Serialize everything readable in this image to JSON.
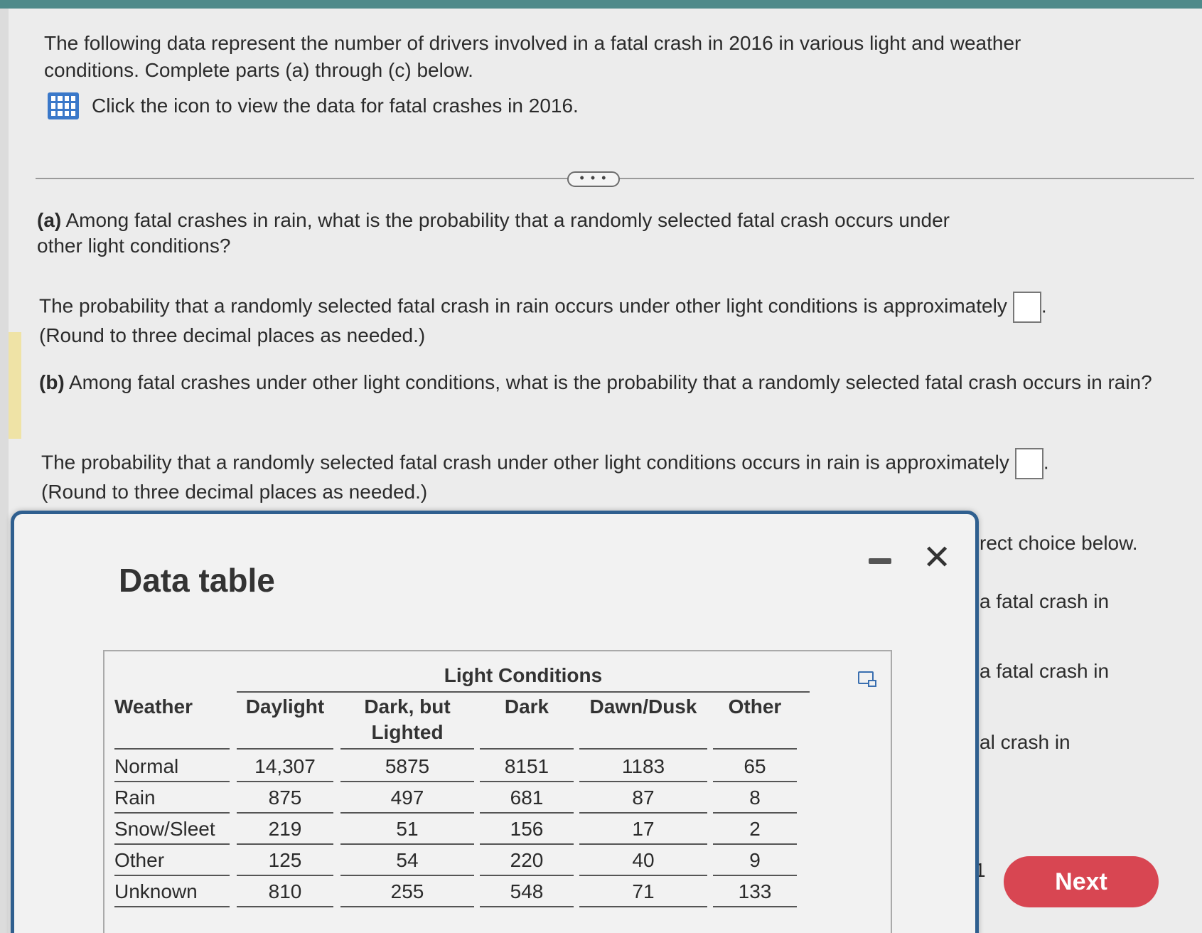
{
  "intro": {
    "text": "The following data represent the number of drivers involved in a fatal crash in 2016 in various light and weather conditions. Complete parts (a) through (c) below.",
    "data_link": "Click the icon to view the data for fatal crashes in 2016."
  },
  "more_label": "• • •",
  "part_a": {
    "label": "(a)",
    "question": "Among fatal crashes in rain, what is the probability that a randomly selected fatal crash occurs under other light conditions?",
    "answer_prefix": "The probability that a randomly selected fatal crash in rain occurs under other light conditions is approximately",
    "round_note": "(Round to three decimal places as needed.)"
  },
  "part_b": {
    "label": "(b)",
    "question": "Among fatal crashes under other light conditions, what is the probability that a randomly selected fatal crash occurs in rain?",
    "answer_prefix": "The probability that a randomly selected fatal crash under other light conditions occurs in rain is approximately",
    "round_note": "(Round to three decimal places as needed.)"
  },
  "behind_modal": {
    "line1": "rect choice below.",
    "line2": "a fatal crash in",
    "line3": "a fatal crash in",
    "line4": "al crash in",
    "one": "1"
  },
  "next_button": "Next",
  "modal": {
    "title": "Data table",
    "close_glyph": "✕",
    "table": {
      "group_header": "Light Conditions",
      "headers": [
        "Weather",
        "Daylight",
        "Dark, but\nLighted",
        "Dark",
        "Dawn/Dusk",
        "Other"
      ],
      "rows": [
        [
          "Normal",
          "14,307",
          "5875",
          "8151",
          "1183",
          "65"
        ],
        [
          "Rain",
          "875",
          "497",
          "681",
          "87",
          "8"
        ],
        [
          "Snow/Sleet",
          "219",
          "51",
          "156",
          "17",
          "2"
        ],
        [
          "Other",
          "125",
          "54",
          "220",
          "40",
          "9"
        ],
        [
          "Unknown",
          "810",
          "255",
          "548",
          "71",
          "133"
        ]
      ]
    }
  }
}
